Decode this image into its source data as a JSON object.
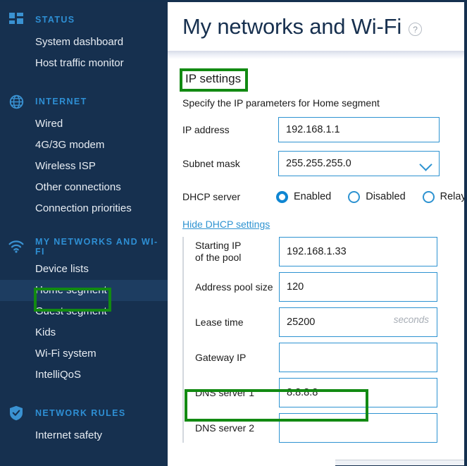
{
  "sidebar": {
    "sections": [
      {
        "icon": "dashboard-grid-icon",
        "label": "STATUS",
        "items": [
          {
            "label": "System dashboard",
            "active": false
          },
          {
            "label": "Host traffic monitor",
            "active": false
          }
        ]
      },
      {
        "icon": "globe-icon",
        "label": "INTERNET",
        "items": [
          {
            "label": "Wired",
            "active": false
          },
          {
            "label": "4G/3G modem",
            "active": false
          },
          {
            "label": "Wireless ISP",
            "active": false
          },
          {
            "label": "Other connections",
            "active": false
          },
          {
            "label": "Connection priorities",
            "active": false
          }
        ]
      },
      {
        "icon": "wifi-icon",
        "label": "MY NETWORKS AND WI-FI",
        "items": [
          {
            "label": "Device lists",
            "active": false
          },
          {
            "label": "Home segment",
            "active": true
          },
          {
            "label": "Guest segment",
            "active": false
          },
          {
            "label": "Kids",
            "active": false
          },
          {
            "label": "Wi-Fi system",
            "active": false
          },
          {
            "label": "IntelliQoS",
            "active": false
          }
        ]
      },
      {
        "icon": "shield-check-icon",
        "label": "NETWORK RULES",
        "items": [
          {
            "label": "Internet safety",
            "active": false
          }
        ]
      }
    ]
  },
  "header": {
    "title": "My networks and Wi-Fi",
    "help_icon": "?"
  },
  "content": {
    "section_title": "IP settings",
    "subtitle": "Specify the IP parameters for Home segment",
    "fields": [
      {
        "label": "IP address",
        "value": "192.168.1.1",
        "type": "text",
        "unit": ""
      },
      {
        "label": "Subnet mask",
        "value": "255.255.255.0",
        "type": "select",
        "unit": ""
      }
    ],
    "dhcp": {
      "label": "DHCP server",
      "options": [
        {
          "label": "Enabled",
          "selected": true
        },
        {
          "label": "Disabled",
          "selected": false
        },
        {
          "label": "Relay",
          "selected": false
        }
      ],
      "help_icon": "?",
      "toggle_link": "Hide DHCP settings",
      "fields": [
        {
          "label_line1": "Starting IP",
          "label_line2": "of the pool",
          "value": "192.168.1.33",
          "unit": ""
        },
        {
          "label_line1": "Address pool size",
          "label_line2": "",
          "value": "120",
          "unit": ""
        },
        {
          "label_line1": "Lease time",
          "label_line2": "",
          "value": "25200",
          "unit": "seconds"
        },
        {
          "label_line1": "Gateway IP",
          "label_line2": "",
          "value": "",
          "unit": ""
        },
        {
          "label_line1": "DNS server 1",
          "label_line2": "",
          "value": "8.8.8.8",
          "unit": ""
        },
        {
          "label_line1": "DNS server 2",
          "label_line2": "",
          "value": "",
          "unit": ""
        }
      ]
    }
  },
  "annotations": [
    {
      "name": "home-segment-highlight",
      "color": "#128a12"
    },
    {
      "name": "ip-settings-highlight",
      "color": "#128a12"
    },
    {
      "name": "dns-server-1-highlight",
      "color": "#128a12"
    }
  ],
  "colors": {
    "sidebar_bg": "#16304f",
    "sidebar_active": "#1d3d61",
    "accent_blue": "#2e93d1",
    "section_header": "#2e8fd4",
    "title_navy": "#17304f",
    "annotation_green": "#128a12"
  }
}
